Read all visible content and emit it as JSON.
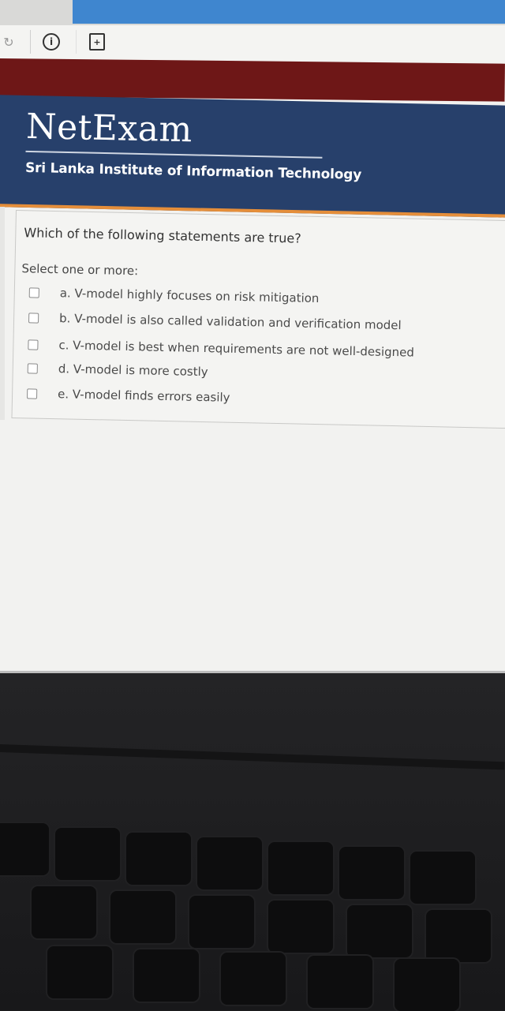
{
  "browser": {
    "reload_icon": "reload-icon",
    "info_icon": "info-icon",
    "page_icon": "page-icon",
    "info_glyph": "i",
    "page_glyph": "+"
  },
  "header": {
    "brand": "NetExam",
    "subtitle": "Sri Lanka Institute of Information Technology"
  },
  "question": {
    "text": "Which of the following statements are true?",
    "prompt": "Select one or more:",
    "options": [
      {
        "label": "a. V-model highly focuses on risk mitigation",
        "checked": false
      },
      {
        "label": "b. V-model is also called validation and verification model",
        "checked": false
      },
      {
        "label": "c. V-model is best when requirements are not well-designed",
        "checked": false
      },
      {
        "label": "d. V-model is more costly",
        "checked": false
      },
      {
        "label": "e. V-model finds errors easily",
        "checked": false
      }
    ]
  },
  "colors": {
    "header_bg": "#27406b",
    "accent": "#e58e3a",
    "top_bar": "#6e1717",
    "tab_blue": "#3f86cf"
  }
}
